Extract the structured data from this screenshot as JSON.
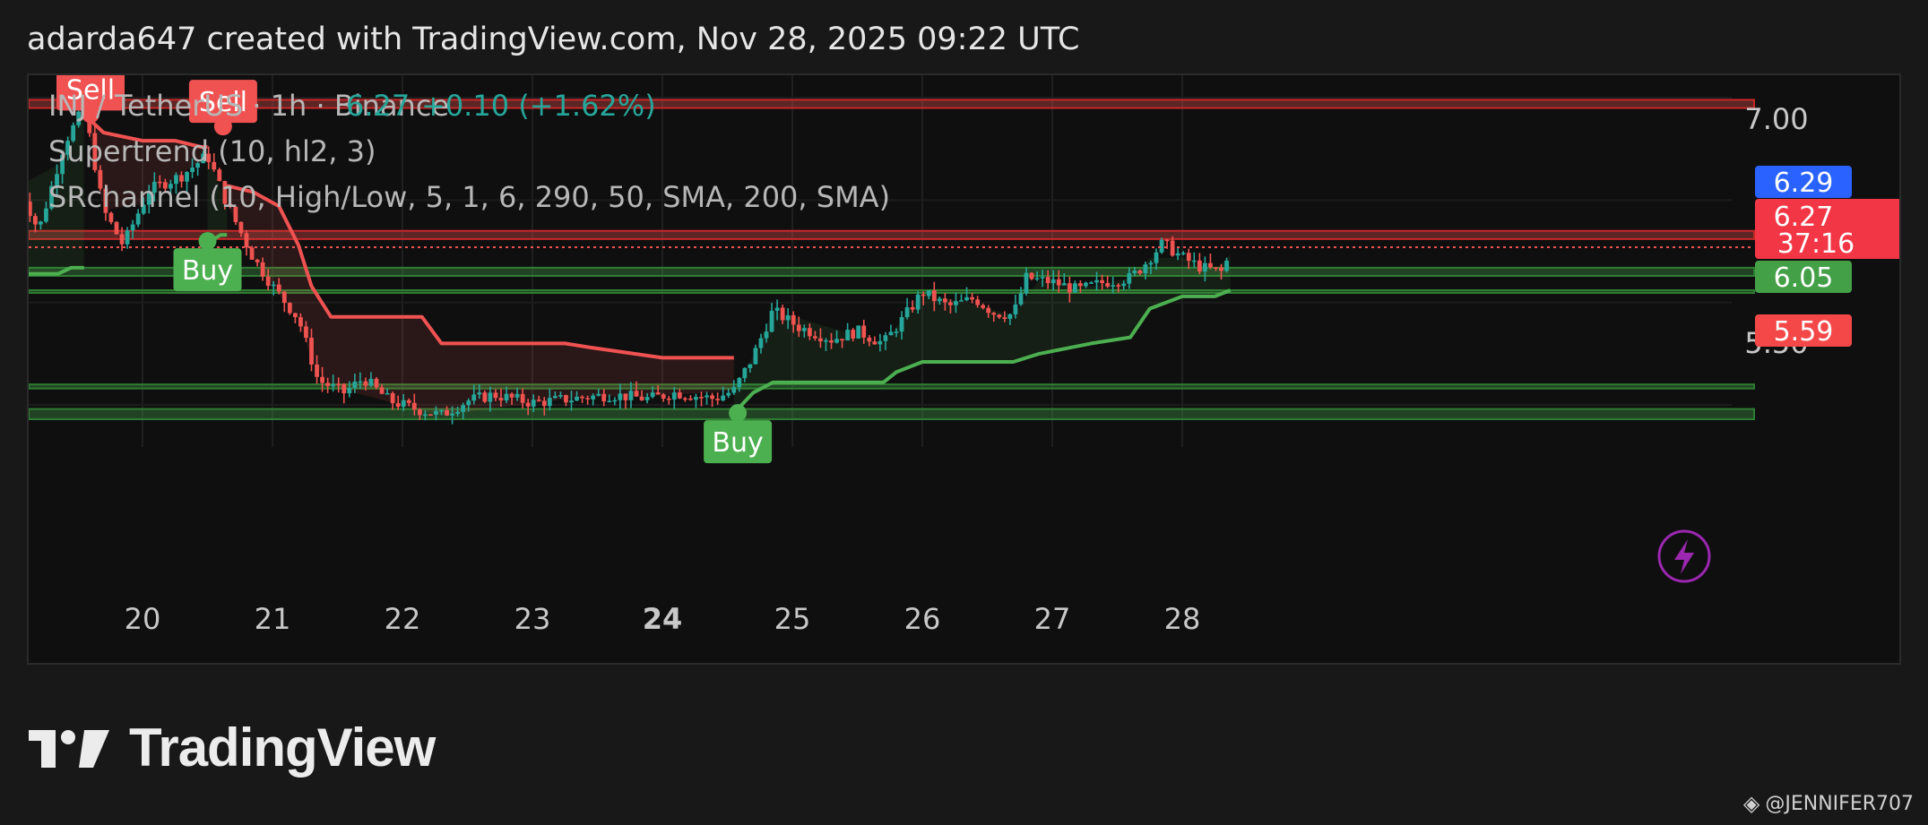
{
  "header": {
    "text": "adarda647 created with TradingView.com, Nov 28, 2025 09:22 UTC"
  },
  "legend": {
    "symbol": "INJ / TetherUS · 1h · Binance",
    "price": "6.27",
    "change": "+0.10 (+1.62%)",
    "indicator1": "Supertrend (10, hl2, 3)",
    "indicator2": "SRchannel (10, High/Low, 5, 1, 6, 290, 50, SMA, 200, SMA)"
  },
  "price_tags": {
    "top": "7.00",
    "hidden": "5.50",
    "blue": "6.29",
    "current": "6.27",
    "countdown": "37:16",
    "green": "6.05",
    "red": "5.59"
  },
  "signals": {
    "sell_1": "Sell",
    "sell_2": "Sell",
    "buy_1": "Buy",
    "buy_2": "Buy"
  },
  "footer": {
    "brand": "TradingView",
    "watermark": "@JENNIFER707"
  },
  "colors": {
    "up": "#26a69a",
    "down": "#ef5350",
    "st_up": "#4caf50",
    "st_down": "#f05252",
    "blue_tag": "#2962ff",
    "green_tag": "#43a047",
    "red_tag": "#f44848"
  },
  "chart_data": {
    "type": "candlestick",
    "x_ticks": [
      "20",
      "21",
      "22",
      "23",
      "24",
      "25",
      "26",
      "27",
      "28"
    ],
    "x_tick_bold": "24",
    "ylim": [
      5.36,
      7.11
    ],
    "y_ticks": [
      7.0,
      5.5
    ],
    "sr_zones": [
      {
        "low": 6.95,
        "high": 6.99,
        "kind": "resistance"
      },
      {
        "low": 6.31,
        "high": 6.35,
        "kind": "resistance"
      },
      {
        "low": 6.13,
        "high": 6.17,
        "kind": "support"
      },
      {
        "low": 6.05,
        "high": 6.06,
        "kind": "support"
      },
      {
        "low": 5.58,
        "high": 5.6,
        "kind": "support"
      },
      {
        "low": 5.43,
        "high": 5.48,
        "kind": "support"
      }
    ],
    "current_price": 6.27,
    "supertrend": [
      {
        "d": 19.05,
        "v": 6.14,
        "trend": "up"
      },
      {
        "d": 19.35,
        "v": 6.14,
        "trend": "up"
      },
      {
        "d": 19.45,
        "v": 6.17,
        "trend": "up"
      },
      {
        "d": 19.55,
        "v": 6.17,
        "trend": "up"
      },
      {
        "d": 19.55,
        "v": 6.92,
        "trend": "down"
      },
      {
        "d": 19.7,
        "v": 6.83,
        "trend": "down"
      },
      {
        "d": 20.0,
        "v": 6.79,
        "trend": "down"
      },
      {
        "d": 20.25,
        "v": 6.79,
        "trend": "down"
      },
      {
        "d": 20.45,
        "v": 6.76,
        "trend": "down"
      },
      {
        "d": 20.5,
        "v": 6.76,
        "trend": "down"
      },
      {
        "d": 20.5,
        "v": 6.29,
        "trend": "up"
      },
      {
        "d": 20.6,
        "v": 6.33,
        "trend": "up"
      },
      {
        "d": 20.65,
        "v": 6.33,
        "trend": "up"
      },
      {
        "d": 20.65,
        "v": 6.57,
        "trend": "down"
      },
      {
        "d": 20.85,
        "v": 6.54,
        "trend": "down"
      },
      {
        "d": 21.05,
        "v": 6.47,
        "trend": "down"
      },
      {
        "d": 21.2,
        "v": 6.28,
        "trend": "down"
      },
      {
        "d": 21.3,
        "v": 6.08,
        "trend": "down"
      },
      {
        "d": 21.45,
        "v": 5.93,
        "trend": "down"
      },
      {
        "d": 22.15,
        "v": 5.93,
        "trend": "down"
      },
      {
        "d": 22.3,
        "v": 5.8,
        "trend": "down"
      },
      {
        "d": 23.25,
        "v": 5.8,
        "trend": "down"
      },
      {
        "d": 23.45,
        "v": 5.78,
        "trend": "down"
      },
      {
        "d": 24.0,
        "v": 5.73,
        "trend": "down"
      },
      {
        "d": 24.55,
        "v": 5.73,
        "trend": "down"
      },
      {
        "d": 24.55,
        "v": 5.46,
        "trend": "up"
      },
      {
        "d": 24.7,
        "v": 5.56,
        "trend": "up"
      },
      {
        "d": 24.85,
        "v": 5.61,
        "trend": "up"
      },
      {
        "d": 25.7,
        "v": 5.61,
        "trend": "up"
      },
      {
        "d": 25.8,
        "v": 5.66,
        "trend": "up"
      },
      {
        "d": 26.0,
        "v": 5.71,
        "trend": "up"
      },
      {
        "d": 26.7,
        "v": 5.71,
        "trend": "up"
      },
      {
        "d": 26.9,
        "v": 5.75,
        "trend": "up"
      },
      {
        "d": 27.3,
        "v": 5.8,
        "trend": "up"
      },
      {
        "d": 27.6,
        "v": 5.83,
        "trend": "up"
      },
      {
        "d": 27.75,
        "v": 5.97,
        "trend": "up"
      },
      {
        "d": 28.0,
        "v": 6.03,
        "trend": "up"
      },
      {
        "d": 28.25,
        "v": 6.03,
        "trend": "up"
      },
      {
        "d": 28.37,
        "v": 6.06,
        "trend": "up"
      }
    ],
    "price_path": [
      [
        19.05,
        6.57
      ],
      [
        19.2,
        6.35
      ],
      [
        19.4,
        6.78
      ],
      [
        19.55,
        6.95
      ],
      [
        19.7,
        6.45
      ],
      [
        19.85,
        6.28
      ],
      [
        20.05,
        6.55
      ],
      [
        20.3,
        6.62
      ],
      [
        20.5,
        6.72
      ],
      [
        20.65,
        6.48
      ],
      [
        20.85,
        6.22
      ],
      [
        21.0,
        6.08
      ],
      [
        21.2,
        5.92
      ],
      [
        21.35,
        5.62
      ],
      [
        21.55,
        5.56
      ],
      [
        21.7,
        5.63
      ],
      [
        21.9,
        5.52
      ],
      [
        22.1,
        5.48
      ],
      [
        22.3,
        5.45
      ],
      [
        22.5,
        5.52
      ],
      [
        22.7,
        5.55
      ],
      [
        23.0,
        5.51
      ],
      [
        23.3,
        5.53
      ],
      [
        23.6,
        5.55
      ],
      [
        23.9,
        5.53
      ],
      [
        24.1,
        5.56
      ],
      [
        24.4,
        5.53
      ],
      [
        24.55,
        5.57
      ],
      [
        24.7,
        5.74
      ],
      [
        24.85,
        5.96
      ],
      [
        25.05,
        5.88
      ],
      [
        25.3,
        5.82
      ],
      [
        25.5,
        5.86
      ],
      [
        25.7,
        5.8
      ],
      [
        25.85,
        5.92
      ],
      [
        26.0,
        6.05
      ],
      [
        26.2,
        5.98
      ],
      [
        26.4,
        6.02
      ],
      [
        26.55,
        5.95
      ],
      [
        26.7,
        5.94
      ],
      [
        26.8,
        6.12
      ],
      [
        27.0,
        6.1
      ],
      [
        27.2,
        6.06
      ],
      [
        27.4,
        6.1
      ],
      [
        27.6,
        6.12
      ],
      [
        27.7,
        6.18
      ],
      [
        27.85,
        6.29
      ],
      [
        28.0,
        6.22
      ],
      [
        28.15,
        6.17
      ],
      [
        28.3,
        6.15
      ],
      [
        28.4,
        6.27
      ]
    ],
    "signals": [
      {
        "d": 19.6,
        "v": 6.92,
        "type": "sell"
      },
      {
        "d": 20.62,
        "v": 6.86,
        "type": "sell"
      },
      {
        "d": 20.5,
        "v": 6.3,
        "type": "buy"
      },
      {
        "d": 24.58,
        "v": 5.46,
        "type": "buy"
      }
    ]
  }
}
